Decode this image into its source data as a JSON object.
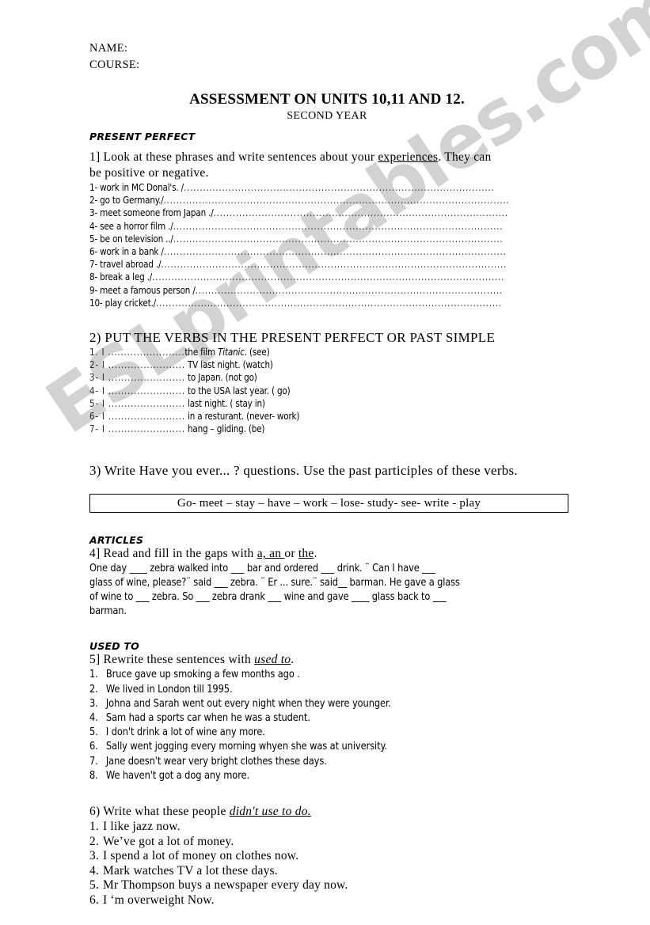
{
  "watermark": {
    "text": "ESLprintables.com",
    "color": "#d2d2d2"
  },
  "header": {
    "name_label": "NAME:",
    "course_label": "COURSE:",
    "title": "ASSESSMENT ON UNITS 10,11 AND 12.",
    "subtitle": "SECOND YEAR"
  },
  "sections": {
    "present_perfect": "PRESENT  PERFECT",
    "articles": "ARTICLES",
    "used_to": "USED TO"
  },
  "ex1": {
    "instruction_line1": "1] Look at these phrases and write sentences about your ",
    "instruction_underline": "experiences",
    "instruction_line1_tail": ". They can",
    "instruction_line2": "be positive or negative.",
    "items": [
      {
        "label": "1- work in  MC Donal's. /",
        "dots": "................................................................................................."
      },
      {
        "label": "2- go to Germany./",
        "dots": "............................................................................................................"
      },
      {
        "label": "3- meet someone from Japan ./",
        "dots": "............................................................................................"
      },
      {
        "label": "4- see a horror film ./",
        "dots": "......................................................................................................."
      },
      {
        "label": "5- be on television ../",
        "dots": "......................................................................................................."
      },
      {
        "label": "6- work in a bank /",
        "dots": "..........................................................................................................."
      },
      {
        "label": "7- travel abroad ./",
        "dots": "............................................................................................................"
      },
      {
        "label": "8- break a leg ./",
        "dots": ".............................................................................................................."
      },
      {
        "label": "9- meet a famous person /",
        "dots": "................................................................................................"
      },
      {
        "label": "10- play cricket./",
        "dots": "............................................................................................................"
      }
    ]
  },
  "ex2": {
    "heading": "2) PUT THE VERBS IN THE PRESENT PERFECT OR PAST SIMPLE",
    "items": [
      {
        "pre": "1. I ........................",
        "mid": "the film ",
        "italic": "Titanic",
        "post": ". (see)"
      },
      {
        "pre": "2- I ........................",
        "mid": " TV last night. (watch)",
        "italic": "",
        "post": ""
      },
      {
        "pre": "3- I ........................",
        "mid": " to Japan. (not go)",
        "italic": "",
        "post": ""
      },
      {
        "pre": "4- I ........................",
        "mid": " to the USA last year. ( go)",
        "italic": "",
        "post": ""
      },
      {
        "pre": "5- I ........................",
        "mid": " last night. ( stay in)",
        "italic": "",
        "post": ""
      },
      {
        "pre": "6- I ........................",
        "mid": " in a resturant. (never- work)",
        "italic": "",
        "post": ""
      },
      {
        "pre": "7- I ........................",
        "mid": " hang – gliding. (be)",
        "italic": "",
        "post": ""
      }
    ]
  },
  "ex3": {
    "instruction": "3) Write  Have you ever... ? questions. Use the past participles of these verbs.",
    "verb_bank": "Go- meet – stay – have – work – lose- study- see- write - play"
  },
  "ex4": {
    "instruction_pre": "4]  Read and fill in the gaps with ",
    "instruction_u1": "a,  an ",
    "instruction_mid": "or ",
    "instruction_u2": "the",
    "instruction_post": ".",
    "paragraph_line1": "One day  ____ zebra walked into ___ bar and ordered ___ drink. ¨ Can I have ___",
    "paragraph_line2": "glass of wine, please?¨ said ___ zebra.  ¨ Er ... sure.¨ said__ barman. He gave a glass",
    "paragraph_line3": "of wine to ___ zebra. So ___ zebra drank ___ wine and gave ____ glass back to ___",
    "paragraph_line4": "barman."
  },
  "ex5": {
    "instruction_pre": "5] Rewrite these sentences with ",
    "instruction_italic_u": "used to",
    "instruction_post": ".",
    "items": [
      {
        "num": "1.",
        "text": "Bruce gave up smoking a few months ago ."
      },
      {
        "num": "2.",
        "text": "We lived in London till 1995."
      },
      {
        "num": "3.",
        "text": "Johna and Sarah went out every night when they were younger."
      },
      {
        "num": "4.",
        "text": "Sam had a sports car when he was a student."
      },
      {
        "num": "5.",
        "text": "I don't drink a lot of  wine any more."
      },
      {
        "num": "6.",
        "text": "Sally went jogging every morning whyen she was at university."
      },
      {
        "num": "7.",
        "text": "Jane doesn't wear very bright clothes these days."
      },
      {
        "num": "8.",
        "text": "We haven't got a dog any more."
      }
    ]
  },
  "ex6": {
    "instruction_pre": "6) Write what these people ",
    "instruction_italic_u": "didn't use to do.",
    "items": [
      {
        "num": "1.",
        "text": "I like jazz now."
      },
      {
        "num": "2.",
        "text": "We’ve got a lot of money."
      },
      {
        "num": "3.",
        "text": "I spend a lot of money on clothes now."
      },
      {
        "num": "4.",
        "text": "Mark watches TV a lot these days."
      },
      {
        "num": "5.",
        "text": "Mr Thompson buys a newspaper every day now."
      },
      {
        "num": "6.",
        "text": "I ‘m overweight Now."
      }
    ]
  }
}
